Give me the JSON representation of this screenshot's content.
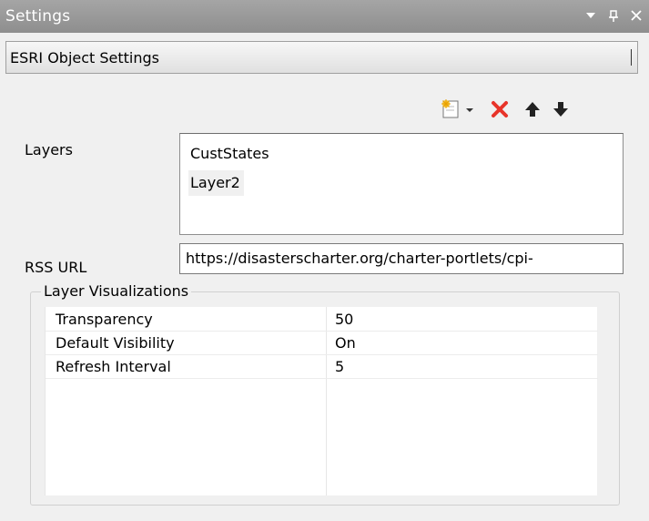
{
  "window": {
    "title": "Settings",
    "controls": {
      "dropdown_icon": "caret-down",
      "pin_icon": "pin",
      "close_icon": "close"
    }
  },
  "object_bar": {
    "label": "ESRI Object Settings"
  },
  "toolbar": {
    "buttons": [
      "new-layer-icon",
      "dropdown-arrow-icon",
      "delete-icon",
      "move-up-icon",
      "move-down-icon"
    ],
    "delete_color": "#e8342a"
  },
  "layers": {
    "label": "Layers",
    "items": [
      "CustStates",
      "Layer2"
    ],
    "selected_index": 1
  },
  "rss": {
    "label": "RSS URL",
    "value": "https://disasterscharter.org/charter-portlets/cpi-"
  },
  "layer_visualizations": {
    "legend": "Layer Visualizations",
    "rows": [
      {
        "name": "Transparency",
        "value": "50"
      },
      {
        "name": "Default Visibility",
        "value": "On"
      },
      {
        "name": "Refresh Interval",
        "value": "5"
      }
    ]
  }
}
